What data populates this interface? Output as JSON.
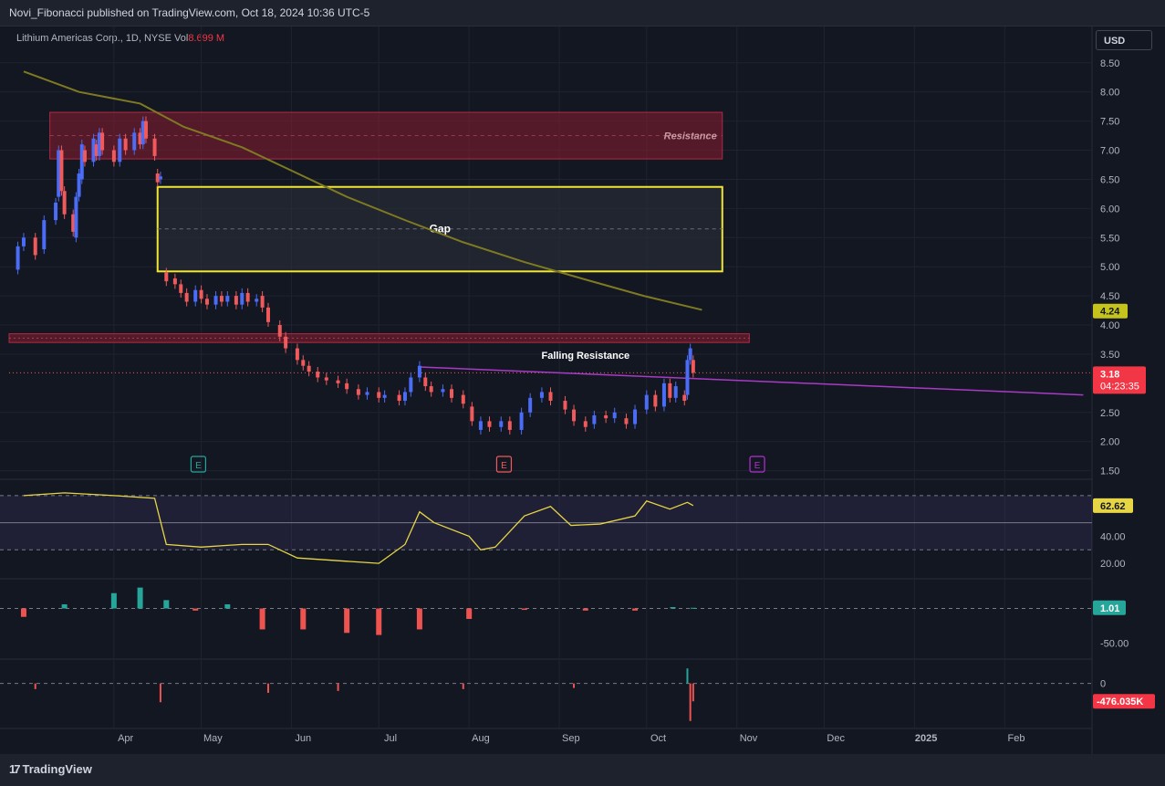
{
  "header": {
    "publisher": "Novi_Fibonacci published on TradingView.com, Oct 18, 2024 10:36 UTC-5"
  },
  "legend": {
    "symbol": "Lithium Americas Corp., 1D, NYSE",
    "vol_label": "Vol",
    "vol_value": "8.699 M"
  },
  "currency": "USD",
  "footer": {
    "brand": "TradingView"
  },
  "colors": {
    "background": "#131722",
    "up": "#4a6cf7",
    "down": "#f05a5a",
    "ma": "#7f7a22",
    "resistance": "#8b1d2f",
    "gap": "#f1e633",
    "trend": "#a83ac6",
    "rsi": "#e6d545",
    "macd_pos": "#26a69a",
    "macd_neg": "#ef5350"
  },
  "chart_data": [
    {
      "type": "candlestick",
      "x_labels": [
        "Apr",
        "May",
        "Jun",
        "Jul",
        "Aug",
        "Sep",
        "Oct",
        "Nov",
        "Dec",
        "2025",
        "Feb"
      ],
      "y_ticks": [
        "8.50",
        "8.00",
        "7.50",
        "7.00",
        "6.50",
        "6.00",
        "5.50",
        "5.00",
        "4.50",
        "4.00",
        "3.50",
        "2.50",
        "2.00",
        "1.50"
      ],
      "ylim": [
        1.4,
        8.7
      ],
      "price_labels": {
        "ma_value": "4.24",
        "last_price": "3.18",
        "countdown": "04:23:35"
      },
      "annotations": {
        "resistance": "Resistance",
        "gap": "Gap",
        "falling": "Falling Resistance",
        "earnings": "E"
      },
      "resistance_zone": [
        6.85,
        7.65
      ],
      "gap_zone": [
        4.92,
        6.37
      ],
      "moving_average": [
        [
          "2024-03-01",
          8.35
        ],
        [
          "2024-03-20",
          8.0
        ],
        [
          "2024-04-10",
          7.8
        ],
        [
          "2024-04-25",
          7.4
        ],
        [
          "2024-05-15",
          7.05
        ],
        [
          "2024-06-01",
          6.65
        ],
        [
          "2024-06-20",
          6.2
        ],
        [
          "2024-07-10",
          5.8
        ],
        [
          "2024-07-30",
          5.42
        ],
        [
          "2024-08-20",
          5.08
        ],
        [
          "2024-09-10",
          4.78
        ],
        [
          "2024-09-30",
          4.5
        ],
        [
          "2024-10-20",
          4.26
        ]
      ],
      "falling_resistance": [
        [
          "2024-07-15",
          3.28
        ],
        [
          "2025-02-28",
          2.8
        ]
      ],
      "candles": [
        [
          "2024-02-28",
          4.95,
          5.35
        ],
        [
          "2024-03-01",
          5.35,
          5.5
        ],
        [
          "2024-03-05",
          5.5,
          5.2
        ],
        [
          "2024-03-08",
          5.3,
          5.8
        ],
        [
          "2024-03-12",
          5.8,
          6.1
        ],
        [
          "2024-03-13",
          6.2,
          7.0
        ],
        [
          "2024-03-14",
          7.0,
          6.3
        ],
        [
          "2024-03-15",
          6.3,
          5.9
        ],
        [
          "2024-03-18",
          5.9,
          5.6
        ],
        [
          "2024-03-19",
          5.5,
          6.2
        ],
        [
          "2024-03-20",
          6.2,
          6.6
        ],
        [
          "2024-03-21",
          6.5,
          7.1
        ],
        [
          "2024-03-22",
          7.0,
          6.8
        ],
        [
          "2024-03-25",
          6.8,
          7.2
        ],
        [
          "2024-03-26",
          7.1,
          6.9
        ],
        [
          "2024-03-27",
          6.9,
          7.3
        ],
        [
          "2024-03-28",
          7.3,
          7.0
        ],
        [
          "2024-04-01",
          7.0,
          6.8
        ],
        [
          "2024-04-03",
          6.8,
          7.2
        ],
        [
          "2024-04-05",
          7.2,
          7.0
        ],
        [
          "2024-04-08",
          7.0,
          7.3
        ],
        [
          "2024-04-10",
          7.3,
          7.1
        ],
        [
          "2024-04-11",
          7.1,
          7.5
        ],
        [
          "2024-04-12",
          7.5,
          7.2
        ],
        [
          "2024-04-15",
          7.2,
          6.9
        ],
        [
          "2024-04-16",
          6.6,
          6.45
        ],
        [
          "2024-04-17",
          6.5,
          6.55
        ],
        [
          "2024-04-19",
          4.9,
          4.75
        ],
        [
          "2024-04-22",
          4.8,
          4.7
        ],
        [
          "2024-04-24",
          4.7,
          4.55
        ],
        [
          "2024-04-26",
          4.55,
          4.4
        ],
        [
          "2024-04-29",
          4.4,
          4.6
        ],
        [
          "2024-05-01",
          4.6,
          4.45
        ],
        [
          "2024-05-03",
          4.45,
          4.35
        ],
        [
          "2024-05-06",
          4.35,
          4.5
        ],
        [
          "2024-05-08",
          4.5,
          4.4
        ],
        [
          "2024-05-10",
          4.4,
          4.5
        ],
        [
          "2024-05-13",
          4.5,
          4.35
        ],
        [
          "2024-05-15",
          4.35,
          4.55
        ],
        [
          "2024-05-17",
          4.55,
          4.4
        ],
        [
          "2024-05-20",
          4.4,
          4.45
        ],
        [
          "2024-05-22",
          4.5,
          4.3
        ],
        [
          "2024-05-24",
          4.3,
          4.05
        ],
        [
          "2024-05-28",
          4.0,
          3.8
        ],
        [
          "2024-05-30",
          3.8,
          3.6
        ],
        [
          "2024-06-03",
          3.6,
          3.4
        ],
        [
          "2024-06-05",
          3.4,
          3.3
        ],
        [
          "2024-06-07",
          3.3,
          3.2
        ],
        [
          "2024-06-10",
          3.2,
          3.1
        ],
        [
          "2024-06-13",
          3.1,
          3.05
        ],
        [
          "2024-06-17",
          3.05,
          3.0
        ],
        [
          "2024-06-20",
          3.0,
          2.9
        ],
        [
          "2024-06-24",
          2.9,
          2.8
        ],
        [
          "2024-06-27",
          2.8,
          2.85
        ],
        [
          "2024-07-01",
          2.85,
          2.75
        ],
        [
          "2024-07-03",
          2.75,
          2.8
        ],
        [
          "2024-07-08",
          2.8,
          2.7
        ],
        [
          "2024-07-10",
          2.7,
          2.85
        ],
        [
          "2024-07-12",
          2.85,
          3.1
        ],
        [
          "2024-07-15",
          3.1,
          3.3
        ],
        [
          "2024-07-17",
          3.1,
          2.95
        ],
        [
          "2024-07-19",
          2.95,
          2.85
        ],
        [
          "2024-07-23",
          2.85,
          2.9
        ],
        [
          "2024-07-26",
          2.9,
          2.75
        ],
        [
          "2024-07-30",
          2.8,
          2.65
        ],
        [
          "2024-08-02",
          2.6,
          2.35
        ],
        [
          "2024-08-05",
          2.2,
          2.35
        ],
        [
          "2024-08-08",
          2.35,
          2.25
        ],
        [
          "2024-08-12",
          2.25,
          2.35
        ],
        [
          "2024-08-15",
          2.35,
          2.2
        ],
        [
          "2024-08-19",
          2.2,
          2.5
        ],
        [
          "2024-08-22",
          2.5,
          2.75
        ],
        [
          "2024-08-26",
          2.75,
          2.85
        ],
        [
          "2024-08-29",
          2.85,
          2.7
        ],
        [
          "2024-09-03",
          2.7,
          2.55
        ],
        [
          "2024-09-06",
          2.55,
          2.35
        ],
        [
          "2024-09-10",
          2.35,
          2.25
        ],
        [
          "2024-09-13",
          2.3,
          2.45
        ],
        [
          "2024-09-17",
          2.45,
          2.4
        ],
        [
          "2024-09-20",
          2.4,
          2.5
        ],
        [
          "2024-09-24",
          2.4,
          2.3
        ],
        [
          "2024-09-27",
          2.3,
          2.55
        ],
        [
          "2024-10-01",
          2.55,
          2.8
        ],
        [
          "2024-10-04",
          2.8,
          2.6
        ],
        [
          "2024-10-07",
          2.6,
          3.0
        ],
        [
          "2024-10-09",
          3.0,
          2.75
        ],
        [
          "2024-10-11",
          2.75,
          2.95
        ],
        [
          "2024-10-14",
          2.8,
          2.7
        ],
        [
          "2024-10-15",
          2.8,
          3.4
        ],
        [
          "2024-10-16",
          3.4,
          3.6
        ],
        [
          "2024-10-17",
          3.4,
          3.18
        ]
      ]
    },
    {
      "type": "line",
      "name": "RSI",
      "y_ticks": [
        "40.00",
        "20.00"
      ],
      "current_label": "62.62",
      "levels": [
        70,
        50,
        30
      ],
      "ylim": [
        10,
        80
      ],
      "values": [
        [
          "2024-03-01",
          70
        ],
        [
          "2024-03-15",
          72
        ],
        [
          "2024-04-01",
          70
        ],
        [
          "2024-04-15",
          68
        ],
        [
          "2024-04-19",
          34
        ],
        [
          "2024-05-01",
          32
        ],
        [
          "2024-05-15",
          34
        ],
        [
          "2024-05-24",
          34
        ],
        [
          "2024-06-03",
          24
        ],
        [
          "2024-06-17",
          22
        ],
        [
          "2024-07-01",
          20
        ],
        [
          "2024-07-10",
          34
        ],
        [
          "2024-07-15",
          58
        ],
        [
          "2024-07-20",
          50
        ],
        [
          "2024-08-01",
          40
        ],
        [
          "2024-08-05",
          30
        ],
        [
          "2024-08-10",
          32
        ],
        [
          "2024-08-20",
          55
        ],
        [
          "2024-08-29",
          62
        ],
        [
          "2024-09-05",
          48
        ],
        [
          "2024-09-15",
          49
        ],
        [
          "2024-09-27",
          55
        ],
        [
          "2024-10-01",
          66
        ],
        [
          "2024-10-09",
          60
        ],
        [
          "2024-10-15",
          65
        ],
        [
          "2024-10-17",
          62.62
        ]
      ]
    },
    {
      "type": "bar",
      "name": "MACD histogram",
      "y_ticks": [
        "0",
        "-50.00"
      ],
      "current_label": "1.01",
      "ylim": [
        -70,
        40
      ],
      "values": [
        [
          "2024-03-01",
          -12
        ],
        [
          "2024-03-15",
          6
        ],
        [
          "2024-04-01",
          22
        ],
        [
          "2024-04-10",
          30
        ],
        [
          "2024-04-19",
          12
        ],
        [
          "2024-04-29",
          -3
        ],
        [
          "2024-05-10",
          6
        ],
        [
          "2024-05-22",
          -30
        ],
        [
          "2024-06-05",
          -30
        ],
        [
          "2024-06-20",
          -35
        ],
        [
          "2024-07-01",
          -38
        ],
        [
          "2024-07-15",
          -30
        ],
        [
          "2024-08-01",
          -15
        ],
        [
          "2024-08-20",
          -2
        ],
        [
          "2024-09-10",
          -3
        ],
        [
          "2024-09-27",
          -3
        ],
        [
          "2024-10-10",
          2
        ],
        [
          "2024-10-17",
          1.01
        ]
      ]
    },
    {
      "type": "bar",
      "name": "Volume oscillator",
      "y_ticks": [
        "0"
      ],
      "current_label": "-476.035K",
      "ylim": [
        -1200,
        600
      ],
      "values": [
        [
          "2024-03-05",
          -150
        ],
        [
          "2024-04-17",
          -500
        ],
        [
          "2024-05-24",
          -250
        ],
        [
          "2024-06-17",
          -200
        ],
        [
          "2024-07-30",
          -150
        ],
        [
          "2024-09-06",
          -120
        ],
        [
          "2024-10-15",
          400
        ],
        [
          "2024-10-16",
          -1000
        ],
        [
          "2024-10-17",
          -476
        ]
      ]
    }
  ]
}
